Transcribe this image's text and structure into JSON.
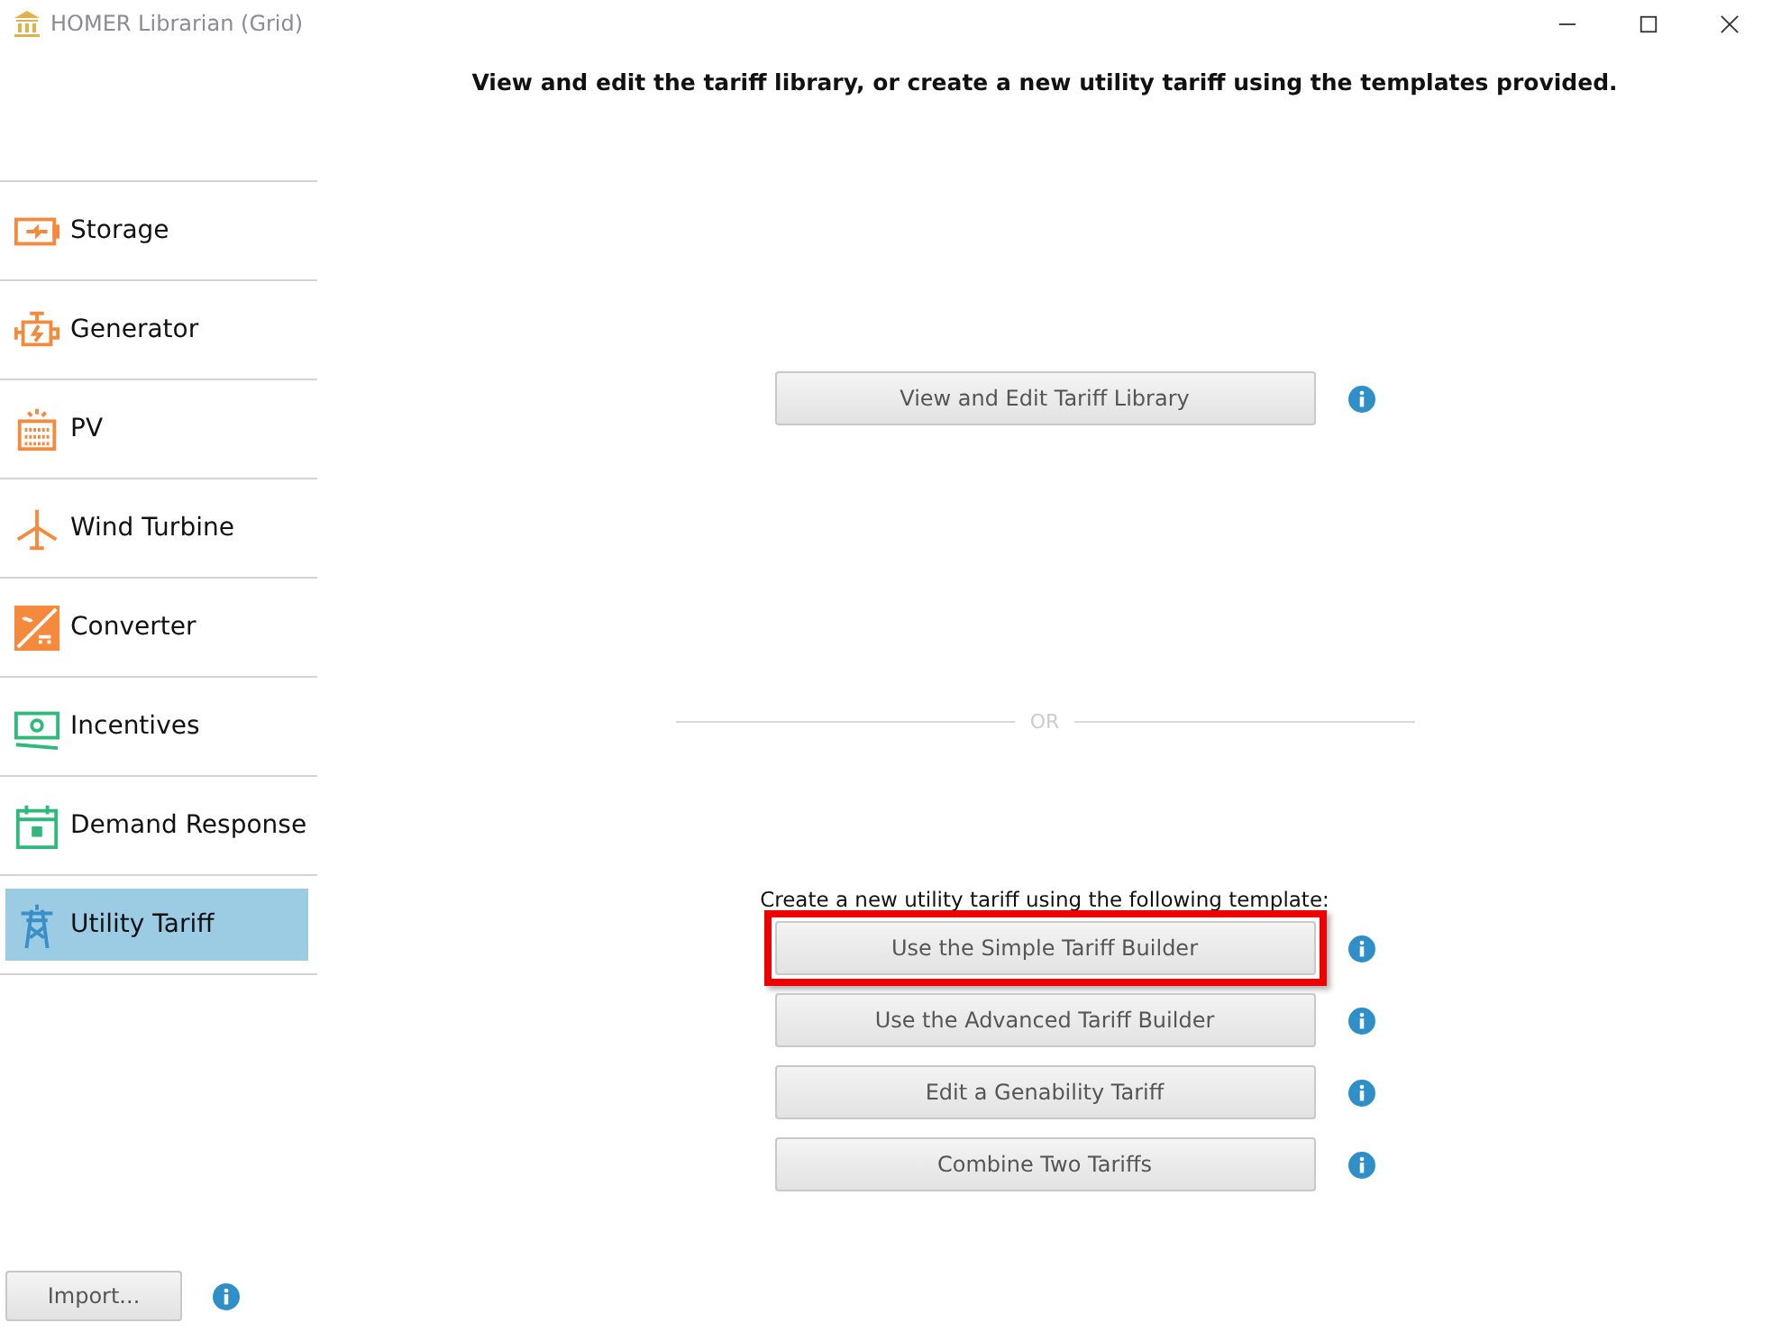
{
  "window": {
    "title": "HOMER Librarian (Grid)"
  },
  "heading": "View and edit the tariff library, or create a new utility tariff using the templates provided.",
  "sidebar": {
    "items": [
      {
        "kind": "storage",
        "label": "Storage",
        "selected": false
      },
      {
        "kind": "generator",
        "label": "Generator",
        "selected": false
      },
      {
        "kind": "pv",
        "label": "PV",
        "selected": false
      },
      {
        "kind": "wind",
        "label": "Wind Turbine",
        "selected": false
      },
      {
        "kind": "converter",
        "label": "Converter",
        "selected": false
      },
      {
        "kind": "incentives",
        "label": "Incentives",
        "selected": false
      },
      {
        "kind": "demand",
        "label": "Demand Response",
        "selected": false
      },
      {
        "kind": "tariff",
        "label": "Utility Tariff",
        "selected": true
      }
    ]
  },
  "library_button": {
    "label": "View and Edit Tariff Library",
    "highlighted": false
  },
  "divider_label": "OR",
  "template_prompt": "Create a new utility tariff using the following template:",
  "template_buttons": [
    {
      "label": "Use the Simple Tariff Builder",
      "highlighted": true
    },
    {
      "label": "Use the Advanced Tariff Builder",
      "highlighted": false
    },
    {
      "label": "Edit a Genability Tariff",
      "highlighted": false
    },
    {
      "label": "Combine Two Tariffs",
      "highlighted": false
    }
  ],
  "import_button": {
    "label": "Import..."
  }
}
